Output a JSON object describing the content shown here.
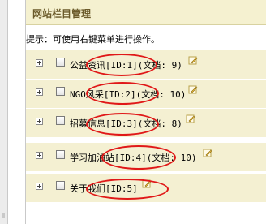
{
  "panel": {
    "title": "网站栏目管理",
    "tip": "提示：可使用右键菜单进行操作。"
  },
  "rows": [
    {
      "label": "公益资讯[ID:1](文档: 9)"
    },
    {
      "label": "NGO风采[ID:2](文档: 10)"
    },
    {
      "label": "招募信息[ID:3](文档: 8)"
    },
    {
      "label": "学习加油站[ID:4](文档: 10)"
    },
    {
      "label": "关于我们[ID:5]"
    }
  ],
  "icons": {
    "expander": "plus-box-icon",
    "edit": "edit-pencil-icon"
  },
  "colors": {
    "header_bg": "#f5f1d0",
    "row_bg": "#f4f0d2",
    "title": "#6b5a2a",
    "annotation": "#e01818"
  }
}
